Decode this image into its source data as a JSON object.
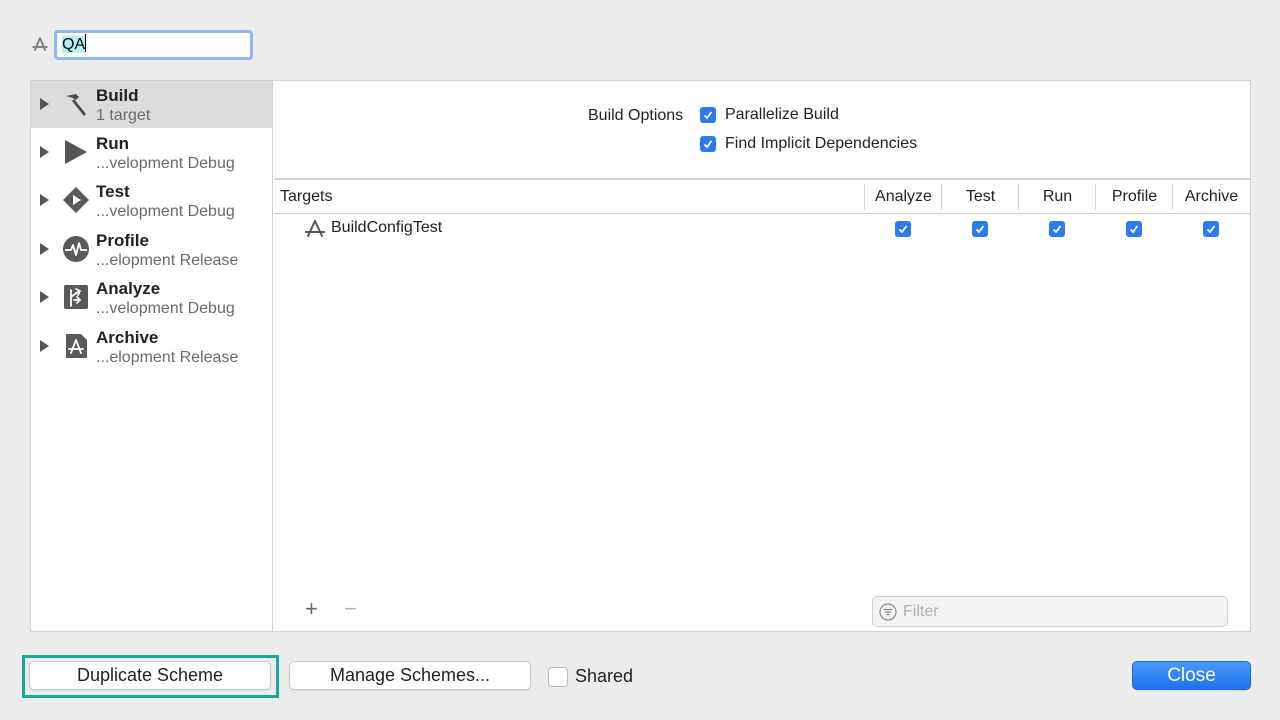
{
  "scheme": {
    "name": "QA",
    "icon": "app-target-icon"
  },
  "sidebar": {
    "items": [
      {
        "label": "Build",
        "subtitle": "1 target",
        "icon": "hammer-icon",
        "selected": true
      },
      {
        "label": "Run",
        "subtitle": "...velopment Debug",
        "icon": "play-icon"
      },
      {
        "label": "Test",
        "subtitle": "...velopment Debug",
        "icon": "test-diamond-icon"
      },
      {
        "label": "Profile",
        "subtitle": "...elopment Release",
        "icon": "waveform-icon"
      },
      {
        "label": "Analyze",
        "subtitle": "...velopment Debug",
        "icon": "analyze-icon"
      },
      {
        "label": "Archive",
        "subtitle": "...elopment Release",
        "icon": "archive-icon"
      }
    ]
  },
  "build_options": {
    "label": "Build Options",
    "options": [
      {
        "label": "Parallelize Build",
        "checked": true
      },
      {
        "label": "Find Implicit Dependencies",
        "checked": true
      }
    ]
  },
  "targets_table": {
    "columns": [
      "Targets",
      "Analyze",
      "Test",
      "Run",
      "Profile",
      "Archive"
    ],
    "rows": [
      {
        "name": "BuildConfigTest",
        "icon": "app-target-icon",
        "analyze": true,
        "test": true,
        "run": true,
        "profile": true,
        "archive": true
      }
    ]
  },
  "table_controls": {
    "add": "+",
    "remove": "−",
    "filter_placeholder": "Filter"
  },
  "footer": {
    "duplicate_label": "Duplicate Scheme",
    "manage_label": "Manage Schemes...",
    "shared_label": "Shared",
    "shared_checked": false,
    "close_label": "Close"
  },
  "colors": {
    "accent": "#2b7cf1",
    "focus_ring": "#18a99a",
    "selection": "#b3f0f4"
  }
}
